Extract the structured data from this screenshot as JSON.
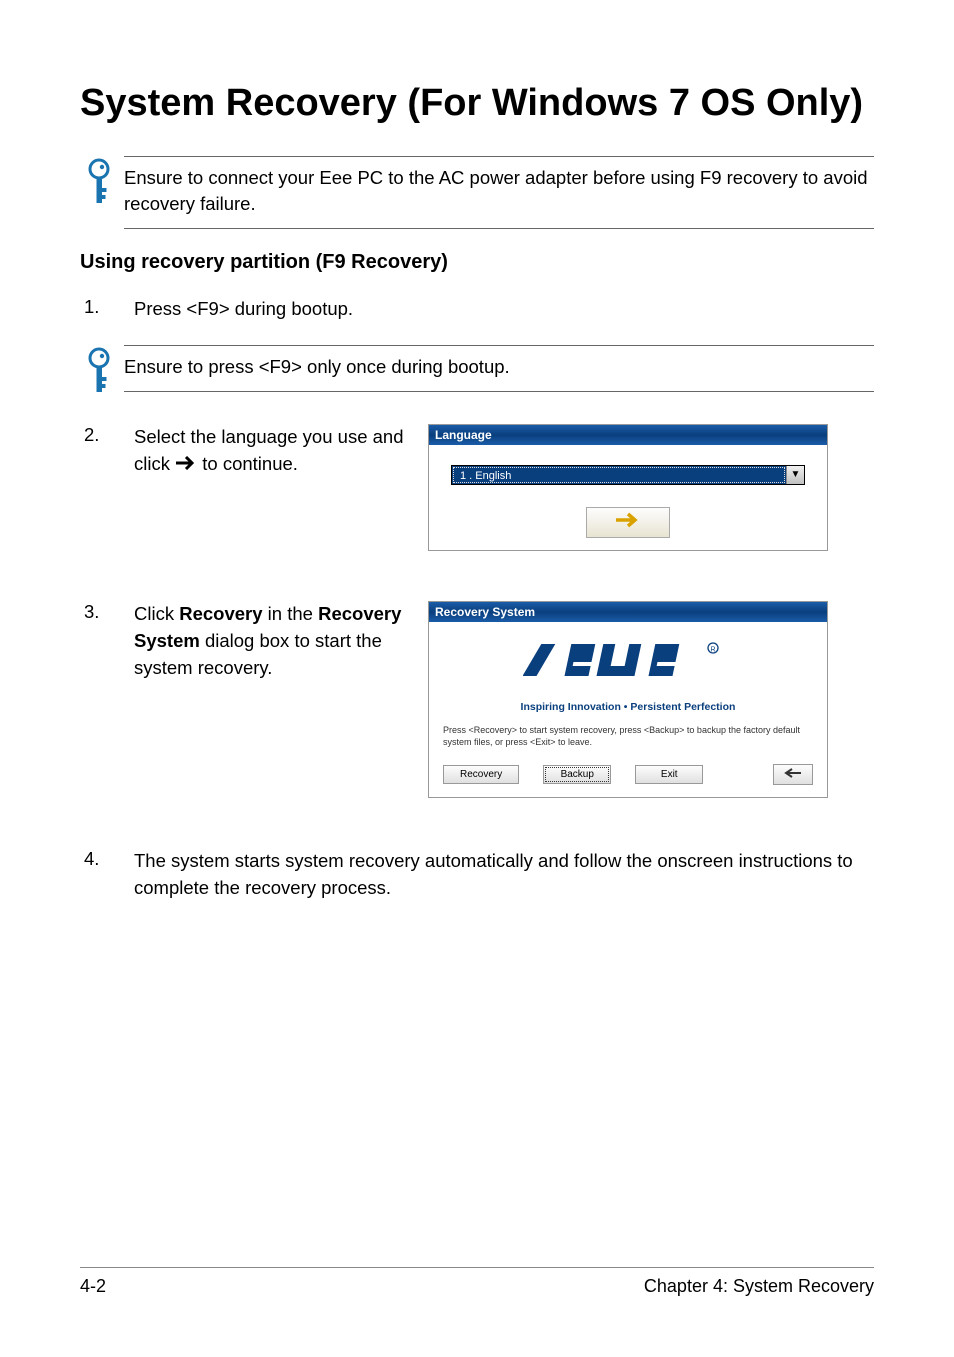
{
  "title": "System Recovery (For Windows 7 OS Only)",
  "note1": "Ensure to connect your Eee PC to the AC power adapter before using F9 recovery to avoid recovery failure.",
  "subheading": "Using recovery partition (F9 Recovery)",
  "step1": {
    "num": "1.",
    "text": "Press <F9> during bootup."
  },
  "note2": "Ensure to press <F9> only once during bootup.",
  "step2": {
    "num": "2.",
    "prefix": "Select the language you use and click ",
    "suffix": " to continue."
  },
  "language_dialog": {
    "title": "Language",
    "selected": "1 . English"
  },
  "step3": {
    "num": "3.",
    "prefix": "Click ",
    "bold1": "Recovery",
    "middle1": " in the ",
    "bold2": "Recovery System",
    "middle2": " dialog box to start the system recovery."
  },
  "recovery_dialog": {
    "title": "Recovery System",
    "tagline": "Inspiring Innovation • Persistent Perfection",
    "instruction": "Press <Recovery> to start system recovery, press <Backup> to backup the factory default system files, or press <Exit> to leave.",
    "btn_recovery": "Recovery",
    "btn_backup": "Backup",
    "btn_exit": "Exit"
  },
  "step4": {
    "num": "4.",
    "text": "The system starts system recovery automatically and follow the onscreen instructions to complete the recovery process."
  },
  "footer": {
    "left": "4-2",
    "right": "Chapter 4: System Recovery"
  }
}
